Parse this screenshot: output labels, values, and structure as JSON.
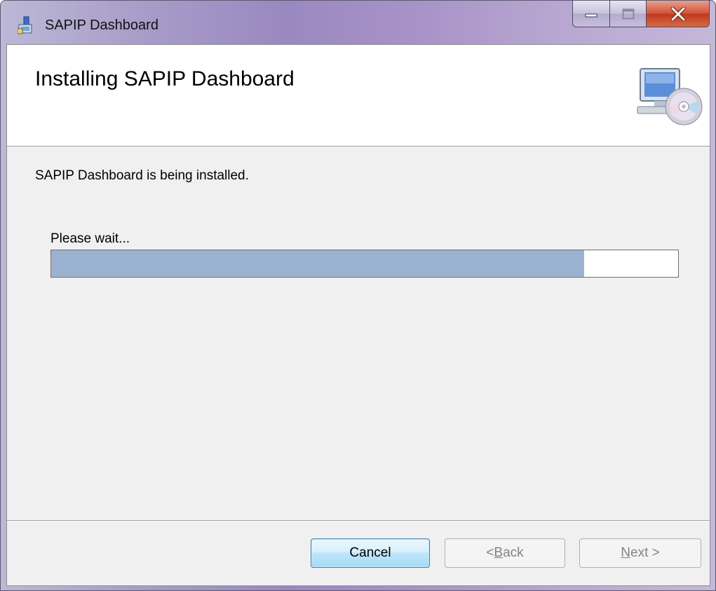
{
  "window": {
    "title": "SAPIP Dashboard",
    "app_icon": "installer-icon"
  },
  "banner": {
    "title": "Installing SAPIP Dashboard",
    "icon": "computer-cd-icon"
  },
  "main": {
    "status_text": "SAPIP Dashboard is being installed.",
    "wait_text": "Please wait...",
    "progress_fraction": 0.85
  },
  "buttons": {
    "cancel": "Cancel",
    "back_prefix": "< ",
    "back_mnemonic": "B",
    "back_rest": "ack",
    "next_mnemonic": "N",
    "next_rest": "ext >"
  },
  "colors": {
    "progress_fill": "#9bb3d1",
    "close_button": "#c8452a"
  }
}
